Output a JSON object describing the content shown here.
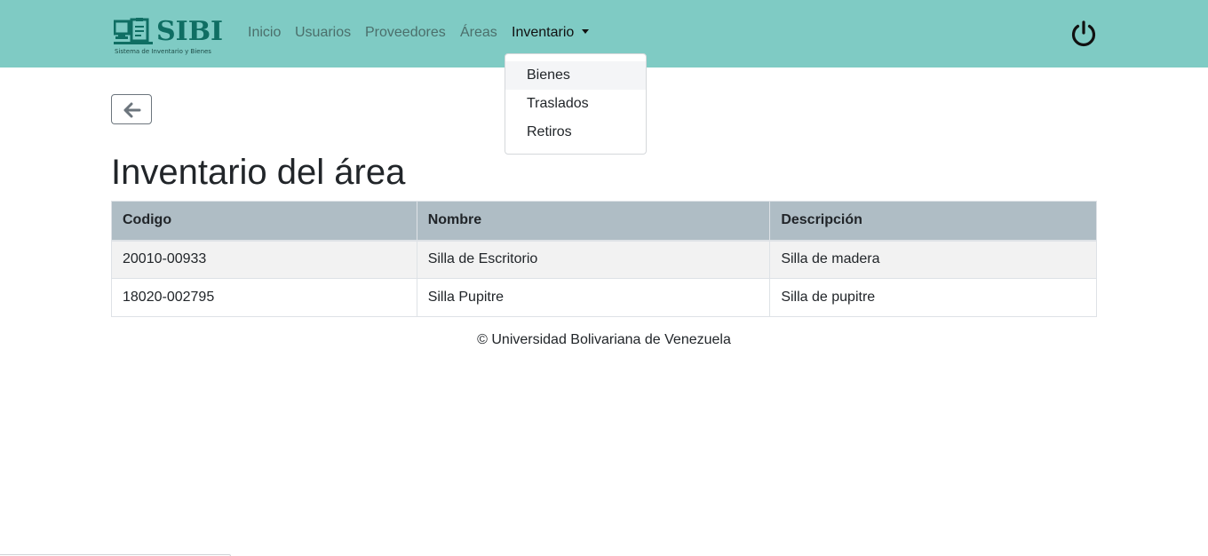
{
  "brand": {
    "title": "SIBI",
    "subtitle": "Sistema de Inventario y Bienes",
    "color": "#0f6e63"
  },
  "nav": {
    "background": "#7fcbc4",
    "links": [
      {
        "label": "Inicio"
      },
      {
        "label": "Usuarios"
      },
      {
        "label": "Proveedores"
      },
      {
        "label": "Áreas"
      },
      {
        "label": "Inventario"
      }
    ],
    "logout_icon": "power-icon"
  },
  "dropdown": {
    "items": [
      {
        "label": "Bienes"
      },
      {
        "label": "Traslados"
      },
      {
        "label": "Retiros"
      }
    ]
  },
  "back_button": {
    "icon": "arrow-left-icon"
  },
  "page": {
    "title": "Inventario del área"
  },
  "table": {
    "headers": [
      "Codigo",
      "Nombre",
      "Descripción"
    ],
    "header_color": "#afbdc5",
    "rows": [
      [
        "20010-00933",
        "Silla de Escritorio",
        "Silla de madera"
      ],
      [
        "18020-002795",
        "Silla Pupitre",
        "Silla de pupitre"
      ]
    ]
  },
  "footer": {
    "text": "© Universidad Bolivariana de Venezuela"
  }
}
